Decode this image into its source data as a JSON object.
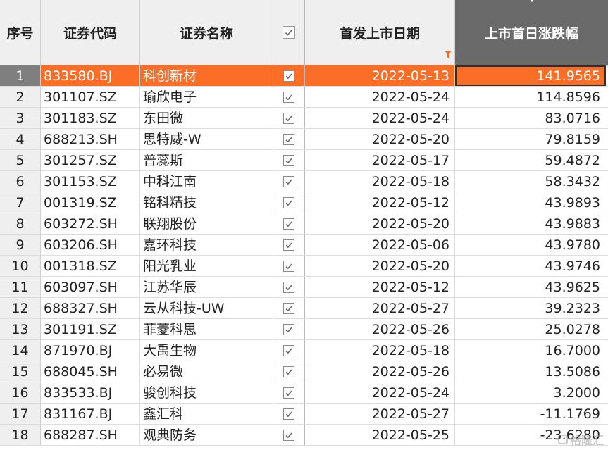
{
  "headers": {
    "index": "序号",
    "code": "证券代码",
    "name": "证券名称",
    "date": "首发上市日期",
    "change": "上市首日涨跌幅"
  },
  "colors": {
    "selected_row": "#fa6e28",
    "sorted_header": "#6a6a6a",
    "filter_icon": "#f07020"
  },
  "rows": [
    {
      "index": "1",
      "code": "833580.BJ",
      "name": "科创新材",
      "date": "2022-05-13",
      "change": "141.9565",
      "checked": true
    },
    {
      "index": "2",
      "code": "301107.SZ",
      "name": "瑜欣电子",
      "date": "2022-05-24",
      "change": "114.8596",
      "checked": true
    },
    {
      "index": "3",
      "code": "301183.SZ",
      "name": "东田微",
      "date": "2022-05-24",
      "change": "83.0716",
      "checked": true
    },
    {
      "index": "4",
      "code": "688213.SH",
      "name": "思特威-W",
      "date": "2022-05-20",
      "change": "79.8159",
      "checked": true
    },
    {
      "index": "5",
      "code": "301257.SZ",
      "name": "普蕊斯",
      "date": "2022-05-17",
      "change": "59.4872",
      "checked": true
    },
    {
      "index": "6",
      "code": "301153.SZ",
      "name": "中科江南",
      "date": "2022-05-18",
      "change": "58.3432",
      "checked": true
    },
    {
      "index": "7",
      "code": "001319.SZ",
      "name": "铭科精技",
      "date": "2022-05-12",
      "change": "43.9893",
      "checked": true
    },
    {
      "index": "8",
      "code": "603272.SH",
      "name": "联翔股份",
      "date": "2022-05-20",
      "change": "43.9883",
      "checked": true
    },
    {
      "index": "9",
      "code": "603206.SH",
      "name": "嘉环科技",
      "date": "2022-05-06",
      "change": "43.9780",
      "checked": true
    },
    {
      "index": "10",
      "code": "001318.SZ",
      "name": "阳光乳业",
      "date": "2022-05-20",
      "change": "43.9746",
      "checked": true
    },
    {
      "index": "11",
      "code": "603097.SH",
      "name": "江苏华辰",
      "date": "2022-05-12",
      "change": "43.9625",
      "checked": true
    },
    {
      "index": "12",
      "code": "688327.SH",
      "name": "云从科技-UW",
      "date": "2022-05-27",
      "change": "39.2323",
      "checked": true
    },
    {
      "index": "13",
      "code": "301191.SZ",
      "name": "菲菱科思",
      "date": "2022-05-26",
      "change": "25.0278",
      "checked": true
    },
    {
      "index": "14",
      "code": "871970.BJ",
      "name": "大禹生物",
      "date": "2022-05-18",
      "change": "16.7000",
      "checked": true
    },
    {
      "index": "15",
      "code": "688045.SH",
      "name": "必易微",
      "date": "2022-05-26",
      "change": "13.5086",
      "checked": true
    },
    {
      "index": "16",
      "code": "833533.BJ",
      "name": "骏创科技",
      "date": "2022-05-24",
      "change": "3.2000",
      "checked": true
    },
    {
      "index": "17",
      "code": "831167.BJ",
      "name": "鑫汇科",
      "date": "2022-05-27",
      "change": "-11.1769",
      "checked": true
    },
    {
      "index": "18",
      "code": "688287.SH",
      "name": "观典防务",
      "date": "2022-05-25",
      "change": "-23.6280",
      "checked": true
    }
  ],
  "watermark": "格隆汇"
}
